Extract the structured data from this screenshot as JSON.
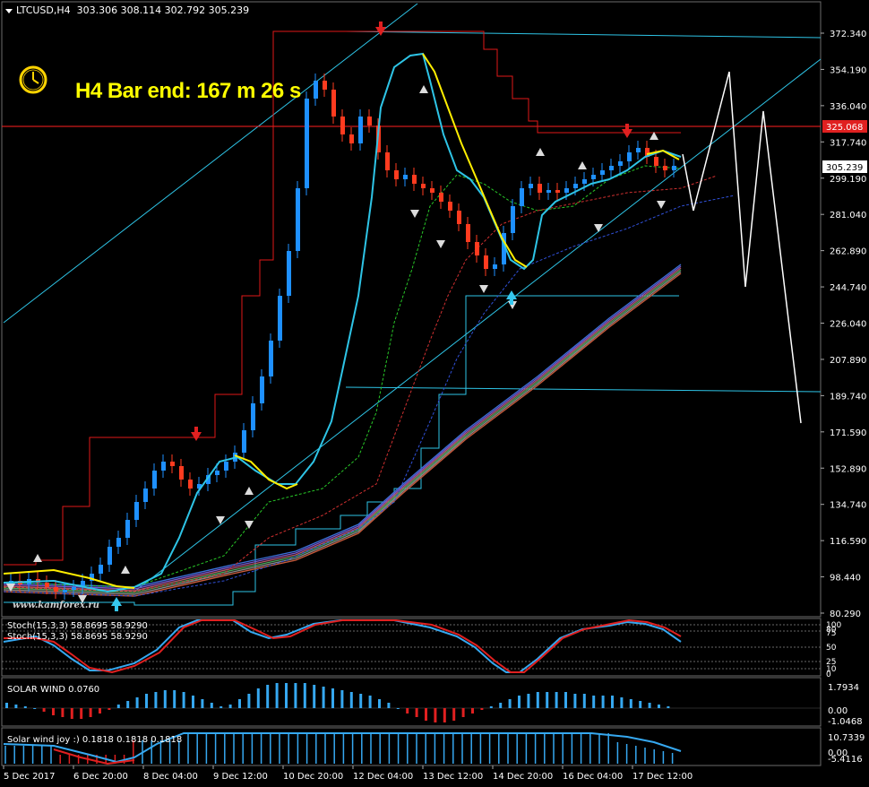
{
  "header": {
    "symbol": "LTCUSD,H4",
    "ohlc": "303.306 308.114 302.792 305.239"
  },
  "timer": {
    "text": "H4 Bar end: 167 m 26 s",
    "icon": "clock-icon"
  },
  "watermark": "www.kamforex.ru",
  "price_axis": {
    "ticks": [
      "372.340",
      "354.190",
      "336.040",
      "317.740",
      "299.190",
      "281.040",
      "262.890",
      "244.740",
      "226.040",
      "207.890",
      "189.740",
      "171.590",
      "152.890",
      "134.740",
      "116.590",
      "98.440",
      "80.290"
    ],
    "current_price": "305.239",
    "level_price": "325.068"
  },
  "time_axis": {
    "ticks": [
      "5 Dec 2017",
      "6 Dec 20:00",
      "8 Dec 04:00",
      "9 Dec 12:00",
      "10 Dec 20:00",
      "12 Dec 04:00",
      "13 Dec 12:00",
      "14 Dec 20:00",
      "16 Dec 04:00",
      "17 Dec 12:00"
    ]
  },
  "stoch": {
    "label1": "Stoch(15,3,3) 58.8695 58.9290",
    "label2": "Stoch(15,3,3) 58.8695 58.9290",
    "levels": [
      "100",
      "80",
      "75",
      "50",
      "25",
      "10",
      "0"
    ]
  },
  "solar_wind": {
    "label": "SOLAR WIND 0.0760",
    "ticks": [
      "1.7934",
      "0.00",
      "-1.0468"
    ]
  },
  "solar_joy": {
    "label": "Solar wind joy :) 0.1818 0.1818 0.1818",
    "ticks": [
      "10.7339",
      "0.00",
      "-5.4116"
    ]
  },
  "colors": {
    "background": "#000000",
    "bull_candle": "#1e90ff",
    "bear_candle": "#ff3b1f",
    "channel_line": "#2ec4e6",
    "level_line": "#ff2020",
    "timer_text": "#ffff00",
    "forecast": "#ffffff"
  }
}
